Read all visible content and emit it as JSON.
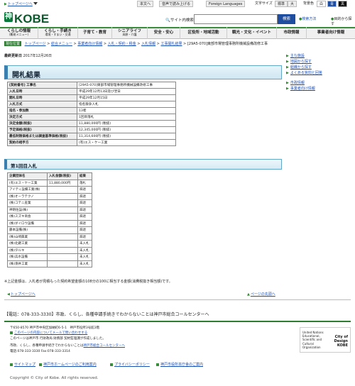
{
  "topstrip": {
    "crumb": "トップページへ",
    "honbun": "本文へ",
    "audio": "音声で読み上げる",
    "lang": "Foreign Languages",
    "fontsize_label": "文字サイズ",
    "standard": "標準",
    "big": "大",
    "bg_label": "背景色",
    "bg_white": "白",
    "bg_blue": "青",
    "bg_black": "黒"
  },
  "header": {
    "logo_text": "KOBE",
    "site_search": "サイト内検索",
    "search_button": "検索",
    "search_help": "検索方法",
    "search_help2": "目的から探す"
  },
  "nav": {
    "items": [
      {
        "label": "くらしの情報",
        "sub": "(難易メニュー)"
      },
      {
        "label": "くらし・手続き",
        "sub": "環境・すまい・交通"
      },
      {
        "label": "子育て・教育",
        "sub": ""
      },
      {
        "label": "シニアライフ",
        "sub": "高齢・介護"
      },
      {
        "label": "安全・安心",
        "sub": ""
      },
      {
        "label": "区役所・地域活動",
        "sub": ""
      },
      {
        "label": "観光・文化・イベント",
        "sub": ""
      },
      {
        "label": "市政情報",
        "sub": ""
      },
      {
        "label": "事業者向け情報",
        "sub": ""
      }
    ]
  },
  "breadcrumb": {
    "here": "現在位置",
    "items": [
      "トップページ",
      "総合メニュー",
      "事業者向け情報",
      "入札・契約・税金",
      "入札情報",
      "工事開札結果"
    ],
    "current": "[29A5-070]東部市場管理事務所機械設備改修工事"
  },
  "updated": {
    "label": "最終更新日",
    "date": "2017年12月26日"
  },
  "main": {
    "title": "開札結果",
    "info": [
      {
        "k": "[契約番号] 工事名",
        "v": "[29A5-070]東部市場管理事務所機械設備改修工事"
      },
      {
        "k": "入札日時",
        "v": "平成29年12月13日及び翌日"
      },
      {
        "k": "開札日時",
        "v": "平成29年12月15日"
      },
      {
        "k": "入札方式",
        "v": "指名競争入札"
      },
      {
        "k": "指名・参加数",
        "v": "13者"
      },
      {
        "k": "決定方式",
        "v": "1回目落札"
      },
      {
        "k": "決定金額(税抜)",
        "v": "11,880,000円  (税抜)"
      },
      {
        "k": "予定価格(税抜)",
        "v": "12,345,000円  (税抜)"
      },
      {
        "k": "最低制限価格または調査基準価格(税抜)",
        "v": "11,314,600円  (税抜)"
      },
      {
        "k": "契約の相手方",
        "v": "(有)エス・ケー工業"
      }
    ],
    "round_title": "第1回目入札",
    "bid_headers": [
      "企業団体名",
      "入札金額(税抜)",
      "結果"
    ],
    "bids": [
      [
        "(有)エス・ケー工業",
        "11,880,000円",
        "落札"
      ],
      [
        "アイティ設備工業(株)",
        "",
        "辞退"
      ],
      [
        "(株)オーラテクノ",
        "",
        "辞退"
      ],
      [
        "(株)コテニ産業",
        "",
        "辞退"
      ],
      [
        "神明住設(株)",
        "",
        "辞退"
      ],
      [
        "(株)スズキ商会",
        "",
        "辞退"
      ],
      [
        "(株)ダイロウ設備",
        "",
        "辞退"
      ],
      [
        "藤本設備(株)",
        "",
        "辞退"
      ],
      [
        "(株)山崎興業",
        "",
        "辞退"
      ],
      [
        "(株)北鍵工業",
        "",
        "未入札"
      ],
      [
        "(株)タルキ",
        "",
        "未入札"
      ],
      [
        "(株)兵水設備",
        "",
        "未入札"
      ],
      [
        "(株)湊井工業",
        "",
        "未入札"
      ]
    ],
    "note": "※上記金額は、入札者が見積もった契約希望金額の108分の100に相当する金額(消費税抜き相当額)です。",
    "totop": "トップページへ",
    "pagetop": "ページの先頭へ"
  },
  "side": {
    "items": [
      "主な施設",
      "地図から探す",
      "組織から探す",
      "よくある質問と回答",
      "市政情報",
      "事業者向け情報"
    ]
  },
  "footer": {
    "call": "【電話：078-333-3330】市政、くらし、各種申請手続きでわからないことは神戸市総合コールセンターへ",
    "address": "〒650-8570 神戸市中央区加納町6-5-1　神戸市役所3号館3階",
    "contact_link": "このページの内容についてメールで問い合わせする",
    "maker": "このページは神戸市 行財政局 財務部 契約監理課が作成しました。",
    "callcenter": "市政、くらし、各種申請手続きでわからないことは",
    "callcenter_link": "神戸市総合コールセンターへ",
    "tel": "電話:078-333-3330 Fax:078-333-3314",
    "unesco_text": "United Nations Educational, Scientific and Cultural Organization",
    "unesco_design": "City of Design KOBE",
    "links": [
      "サイトマップ",
      "神戸市ホームページのご利用案内",
      "プライバシーポリシー",
      "神戸市役所本庁舎のご案内"
    ],
    "copyright": "Copyright © City of Kobe. All rights reserved."
  }
}
